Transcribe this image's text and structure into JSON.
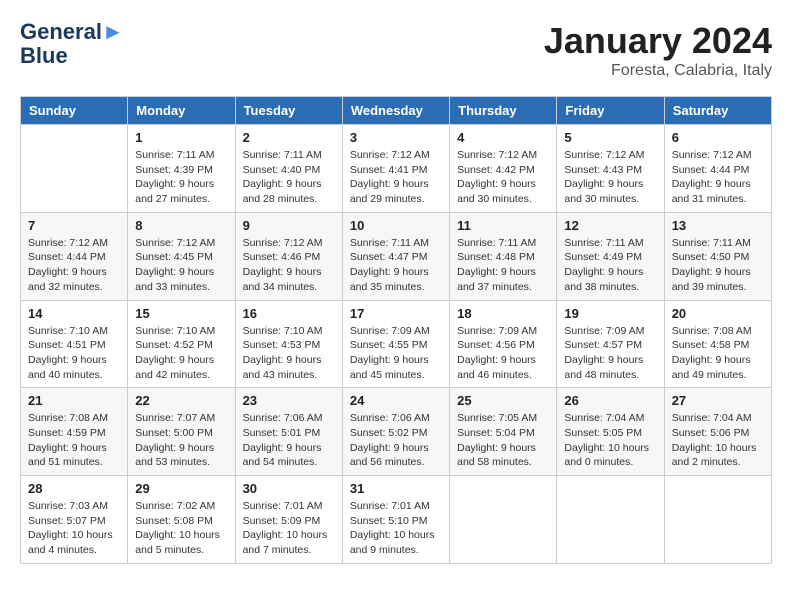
{
  "header": {
    "logo_line1": "General",
    "logo_line2": "Blue",
    "calendar_title": "January 2024",
    "calendar_subtitle": "Foresta, Calabria, Italy"
  },
  "weekdays": [
    "Sunday",
    "Monday",
    "Tuesday",
    "Wednesday",
    "Thursday",
    "Friday",
    "Saturday"
  ],
  "weeks": [
    [
      {
        "day": "",
        "sunrise": "",
        "sunset": "",
        "daylight": ""
      },
      {
        "day": "1",
        "sunrise": "Sunrise: 7:11 AM",
        "sunset": "Sunset: 4:39 PM",
        "daylight": "Daylight: 9 hours and 27 minutes."
      },
      {
        "day": "2",
        "sunrise": "Sunrise: 7:11 AM",
        "sunset": "Sunset: 4:40 PM",
        "daylight": "Daylight: 9 hours and 28 minutes."
      },
      {
        "day": "3",
        "sunrise": "Sunrise: 7:12 AM",
        "sunset": "Sunset: 4:41 PM",
        "daylight": "Daylight: 9 hours and 29 minutes."
      },
      {
        "day": "4",
        "sunrise": "Sunrise: 7:12 AM",
        "sunset": "Sunset: 4:42 PM",
        "daylight": "Daylight: 9 hours and 30 minutes."
      },
      {
        "day": "5",
        "sunrise": "Sunrise: 7:12 AM",
        "sunset": "Sunset: 4:43 PM",
        "daylight": "Daylight: 9 hours and 30 minutes."
      },
      {
        "day": "6",
        "sunrise": "Sunrise: 7:12 AM",
        "sunset": "Sunset: 4:44 PM",
        "daylight": "Daylight: 9 hours and 31 minutes."
      }
    ],
    [
      {
        "day": "7",
        "sunrise": "Sunrise: 7:12 AM",
        "sunset": "Sunset: 4:44 PM",
        "daylight": "Daylight: 9 hours and 32 minutes."
      },
      {
        "day": "8",
        "sunrise": "Sunrise: 7:12 AM",
        "sunset": "Sunset: 4:45 PM",
        "daylight": "Daylight: 9 hours and 33 minutes."
      },
      {
        "day": "9",
        "sunrise": "Sunrise: 7:12 AM",
        "sunset": "Sunset: 4:46 PM",
        "daylight": "Daylight: 9 hours and 34 minutes."
      },
      {
        "day": "10",
        "sunrise": "Sunrise: 7:11 AM",
        "sunset": "Sunset: 4:47 PM",
        "daylight": "Daylight: 9 hours and 35 minutes."
      },
      {
        "day": "11",
        "sunrise": "Sunrise: 7:11 AM",
        "sunset": "Sunset: 4:48 PM",
        "daylight": "Daylight: 9 hours and 37 minutes."
      },
      {
        "day": "12",
        "sunrise": "Sunrise: 7:11 AM",
        "sunset": "Sunset: 4:49 PM",
        "daylight": "Daylight: 9 hours and 38 minutes."
      },
      {
        "day": "13",
        "sunrise": "Sunrise: 7:11 AM",
        "sunset": "Sunset: 4:50 PM",
        "daylight": "Daylight: 9 hours and 39 minutes."
      }
    ],
    [
      {
        "day": "14",
        "sunrise": "Sunrise: 7:10 AM",
        "sunset": "Sunset: 4:51 PM",
        "daylight": "Daylight: 9 hours and 40 minutes."
      },
      {
        "day": "15",
        "sunrise": "Sunrise: 7:10 AM",
        "sunset": "Sunset: 4:52 PM",
        "daylight": "Daylight: 9 hours and 42 minutes."
      },
      {
        "day": "16",
        "sunrise": "Sunrise: 7:10 AM",
        "sunset": "Sunset: 4:53 PM",
        "daylight": "Daylight: 9 hours and 43 minutes."
      },
      {
        "day": "17",
        "sunrise": "Sunrise: 7:09 AM",
        "sunset": "Sunset: 4:55 PM",
        "daylight": "Daylight: 9 hours and 45 minutes."
      },
      {
        "day": "18",
        "sunrise": "Sunrise: 7:09 AM",
        "sunset": "Sunset: 4:56 PM",
        "daylight": "Daylight: 9 hours and 46 minutes."
      },
      {
        "day": "19",
        "sunrise": "Sunrise: 7:09 AM",
        "sunset": "Sunset: 4:57 PM",
        "daylight": "Daylight: 9 hours and 48 minutes."
      },
      {
        "day": "20",
        "sunrise": "Sunrise: 7:08 AM",
        "sunset": "Sunset: 4:58 PM",
        "daylight": "Daylight: 9 hours and 49 minutes."
      }
    ],
    [
      {
        "day": "21",
        "sunrise": "Sunrise: 7:08 AM",
        "sunset": "Sunset: 4:59 PM",
        "daylight": "Daylight: 9 hours and 51 minutes."
      },
      {
        "day": "22",
        "sunrise": "Sunrise: 7:07 AM",
        "sunset": "Sunset: 5:00 PM",
        "daylight": "Daylight: 9 hours and 53 minutes."
      },
      {
        "day": "23",
        "sunrise": "Sunrise: 7:06 AM",
        "sunset": "Sunset: 5:01 PM",
        "daylight": "Daylight: 9 hours and 54 minutes."
      },
      {
        "day": "24",
        "sunrise": "Sunrise: 7:06 AM",
        "sunset": "Sunset: 5:02 PM",
        "daylight": "Daylight: 9 hours and 56 minutes."
      },
      {
        "day": "25",
        "sunrise": "Sunrise: 7:05 AM",
        "sunset": "Sunset: 5:04 PM",
        "daylight": "Daylight: 9 hours and 58 minutes."
      },
      {
        "day": "26",
        "sunrise": "Sunrise: 7:04 AM",
        "sunset": "Sunset: 5:05 PM",
        "daylight": "Daylight: 10 hours and 0 minutes."
      },
      {
        "day": "27",
        "sunrise": "Sunrise: 7:04 AM",
        "sunset": "Sunset: 5:06 PM",
        "daylight": "Daylight: 10 hours and 2 minutes."
      }
    ],
    [
      {
        "day": "28",
        "sunrise": "Sunrise: 7:03 AM",
        "sunset": "Sunset: 5:07 PM",
        "daylight": "Daylight: 10 hours and 4 minutes."
      },
      {
        "day": "29",
        "sunrise": "Sunrise: 7:02 AM",
        "sunset": "Sunset: 5:08 PM",
        "daylight": "Daylight: 10 hours and 5 minutes."
      },
      {
        "day": "30",
        "sunrise": "Sunrise: 7:01 AM",
        "sunset": "Sunset: 5:09 PM",
        "daylight": "Daylight: 10 hours and 7 minutes."
      },
      {
        "day": "31",
        "sunrise": "Sunrise: 7:01 AM",
        "sunset": "Sunset: 5:10 PM",
        "daylight": "Daylight: 10 hours and 9 minutes."
      },
      {
        "day": "",
        "sunrise": "",
        "sunset": "",
        "daylight": ""
      },
      {
        "day": "",
        "sunrise": "",
        "sunset": "",
        "daylight": ""
      },
      {
        "day": "",
        "sunrise": "",
        "sunset": "",
        "daylight": ""
      }
    ]
  ]
}
